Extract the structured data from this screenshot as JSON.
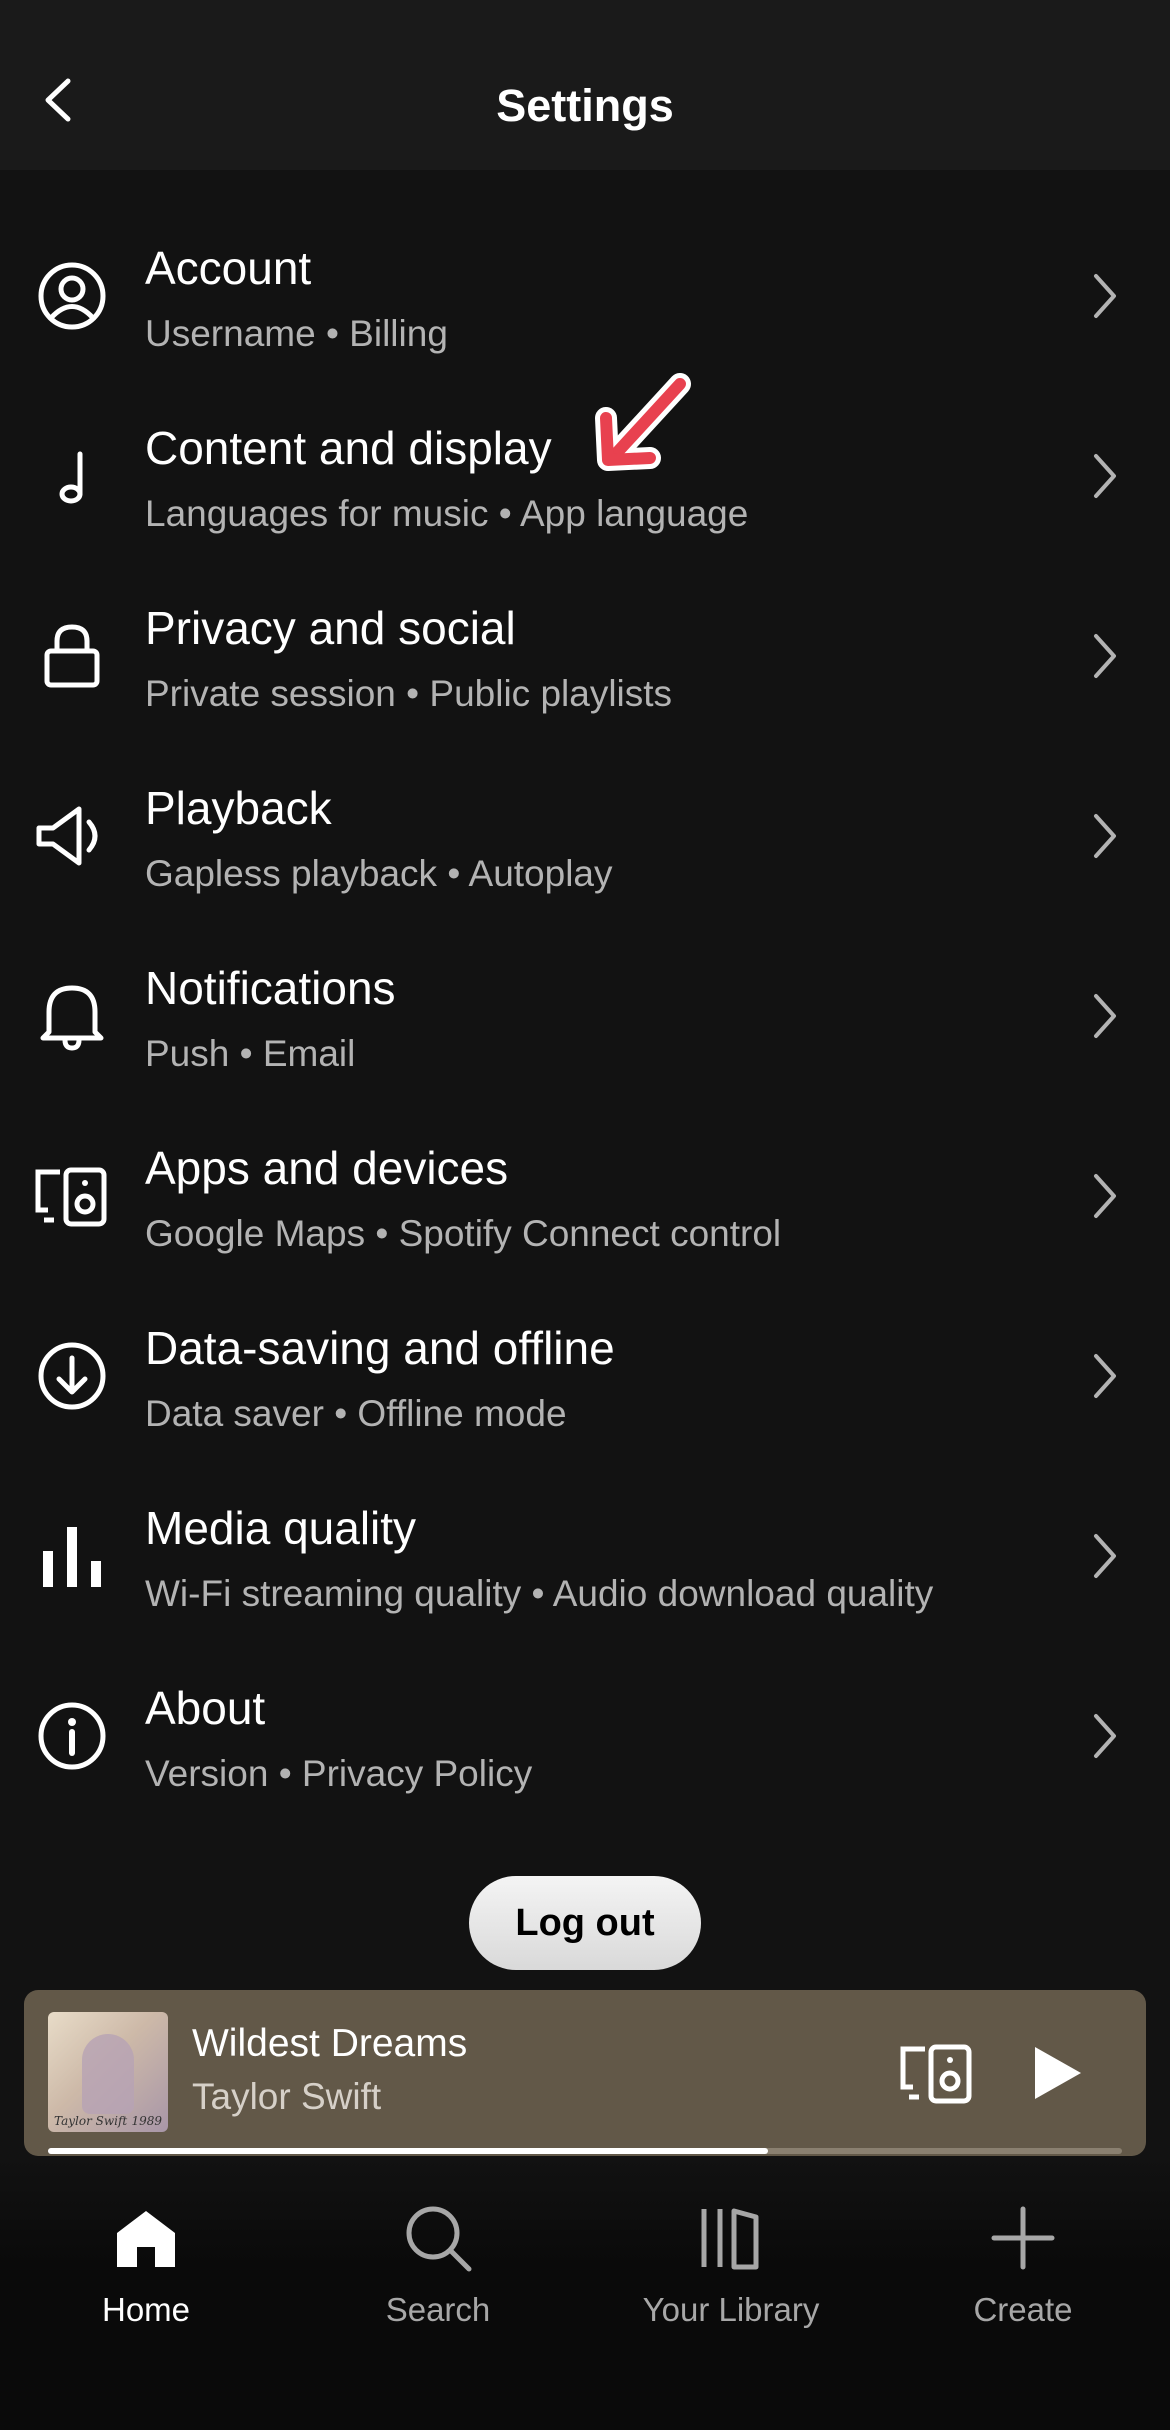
{
  "header": {
    "title": "Settings"
  },
  "settings": [
    {
      "title": "Account",
      "subtitle": "Username • Billing",
      "icon": "account-icon"
    },
    {
      "title": "Content and display",
      "subtitle": "Languages for music • App language",
      "icon": "music-note-icon"
    },
    {
      "title": "Privacy and social",
      "subtitle": "Private session • Public playlists",
      "icon": "lock-icon"
    },
    {
      "title": "Playback",
      "subtitle": "Gapless playback • Autoplay",
      "icon": "speaker-icon"
    },
    {
      "title": "Notifications",
      "subtitle": "Push • Email",
      "icon": "bell-icon"
    },
    {
      "title": "Apps and devices",
      "subtitle": "Google Maps • Spotify Connect control",
      "icon": "devices-icon"
    },
    {
      "title": "Data-saving and offline",
      "subtitle": "Data saver • Offline mode",
      "icon": "download-icon"
    },
    {
      "title": "Media quality",
      "subtitle": "Wi-Fi streaming quality • Audio download quality",
      "icon": "bar-chart-icon"
    },
    {
      "title": "About",
      "subtitle": "Version • Privacy Policy",
      "icon": "info-icon"
    }
  ],
  "logout": {
    "label": "Log out"
  },
  "player": {
    "track": "Wildest Dreams",
    "artist": "Taylor Swift",
    "album_caption": "Taylor Swift",
    "album_year": "1989",
    "progress": 0.67
  },
  "nav": [
    {
      "label": "Home",
      "icon": "home-icon",
      "active": true
    },
    {
      "label": "Search",
      "icon": "search-icon",
      "active": false
    },
    {
      "label": "Your Library",
      "icon": "library-icon",
      "active": false
    },
    {
      "label": "Create",
      "icon": "plus-icon",
      "active": false
    }
  ],
  "colors": {
    "background": "#121212",
    "header": "#1a1a1a",
    "subtitle": "#b3b3b3",
    "player": "#625848",
    "annotation": "#e8414f"
  }
}
